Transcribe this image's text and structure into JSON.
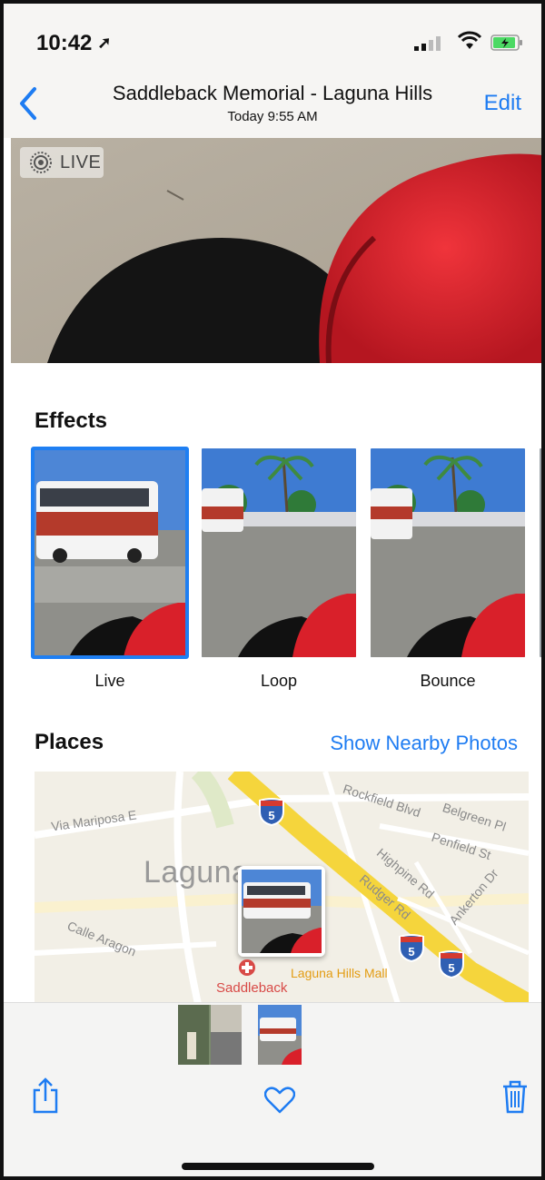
{
  "status_bar": {
    "time": "10:42",
    "location_icon": "location-arrow-icon",
    "signal_icon": "cellular-signal-icon",
    "wifi_icon": "wifi-icon",
    "battery_icon": "battery-charging-icon"
  },
  "nav": {
    "back_icon": "chevron-left-icon",
    "title": "Saddleback Memorial - Laguna Hills",
    "subtitle": "Today  9:55 AM",
    "edit_label": "Edit"
  },
  "hero": {
    "live_badge": "LIVE",
    "live_icon": "live-photo-icon"
  },
  "effects": {
    "title": "Effects",
    "items": [
      {
        "label": "Live",
        "selected": true
      },
      {
        "label": "Loop",
        "selected": false
      },
      {
        "label": "Bounce",
        "selected": false
      }
    ]
  },
  "places": {
    "title": "Places",
    "show_nearby": "Show Nearby Photos",
    "map": {
      "place_label": "Laguna",
      "saddleback": "Saddleback",
      "mall": "Laguna Hills Mall",
      "streets": [
        "Via Mariposa E",
        "Rockfield Blvd",
        "Belgreen Pl",
        "Penfield St",
        "Highpine Rd",
        "Rudger Rd",
        "Ankerton Dr",
        "Calle Aragon"
      ],
      "shield": "5"
    }
  },
  "toolbar": {
    "share_icon": "share-icon",
    "favorite_icon": "heart-icon",
    "delete_icon": "trash-icon"
  },
  "colors": {
    "accent": "#1e7cf2",
    "red_object": "#d9202a",
    "freeway": "#f3d34a"
  }
}
